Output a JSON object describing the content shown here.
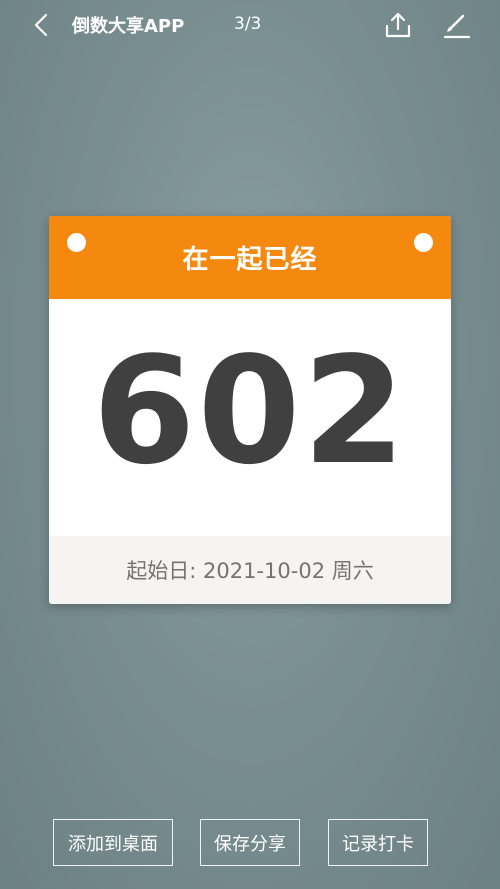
{
  "topbar": {
    "app_title": "倒数大享APP",
    "page_count": "3/3",
    "icons": {
      "back": "chevron-left-icon",
      "share": "upload-share-icon",
      "edit": "pencil-icon"
    }
  },
  "card": {
    "title": "在一起已经",
    "number": "602",
    "start_label": "起始日:",
    "start_date": "2021-10-02",
    "weekday": "周六",
    "colors": {
      "header": "#f5890f",
      "number": "#404040",
      "footer_bg": "#f5f4f2"
    }
  },
  "actions": {
    "add_to_desktop": "添加到桌面",
    "save_share": "保存分享",
    "check_in": "记录打卡"
  },
  "colors": {
    "background": "#7a8f92"
  }
}
